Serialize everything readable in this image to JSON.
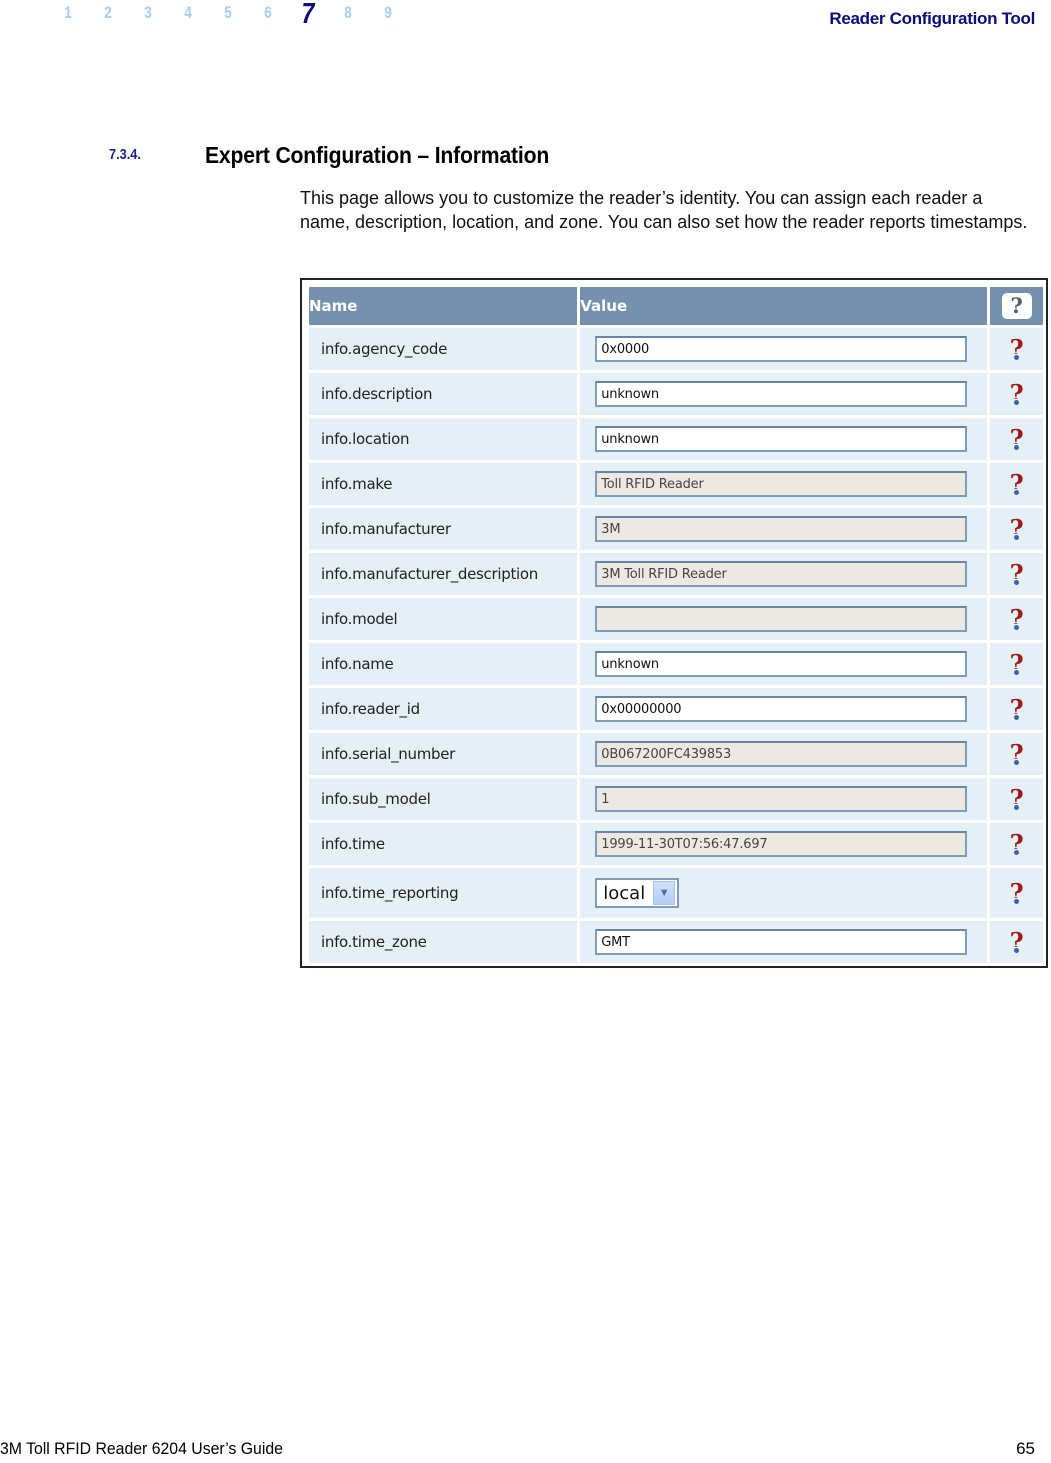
{
  "header": {
    "chapters": [
      "1",
      "2",
      "3",
      "4",
      "5",
      "6",
      "7",
      "8",
      "9"
    ],
    "active_chapter": "7",
    "doc_title": "Reader Configuration Tool"
  },
  "section": {
    "number": "7.3.4.",
    "title": "Expert Configuration – Information",
    "intro": "This page allows you to customize the reader’s identity. You can assign each reader a name, description, location, and zone. You can also set how the reader reports timestamps."
  },
  "table": {
    "columns": {
      "name": "Name",
      "value": "Value",
      "help": "?"
    },
    "rows": [
      {
        "name": "info.agency_code",
        "value": "0x0000",
        "readonly": false
      },
      {
        "name": "info.description",
        "value": "unknown",
        "readonly": false
      },
      {
        "name": "info.location",
        "value": "unknown",
        "readonly": false
      },
      {
        "name": "info.make",
        "value": "Toll RFID Reader",
        "readonly": true
      },
      {
        "name": "info.manufacturer",
        "value": "3M",
        "readonly": true
      },
      {
        "name": "info.manufacturer_description",
        "value": "3M Toll RFID Reader",
        "readonly": true
      },
      {
        "name": "info.model",
        "value": "",
        "readonly": true
      },
      {
        "name": "info.name",
        "value": "unknown",
        "readonly": false
      },
      {
        "name": "info.reader_id",
        "value": "0x00000000",
        "readonly": false
      },
      {
        "name": "info.serial_number",
        "value": "0B067200FC439853",
        "readonly": true
      },
      {
        "name": "info.sub_model",
        "value": "1",
        "readonly": true
      },
      {
        "name": "info.time",
        "value": "1999-11-30T07:56:47.697",
        "readonly": true
      },
      {
        "name": "info.time_reporting",
        "value": "local",
        "type": "select"
      },
      {
        "name": "info.time_zone",
        "value": "GMT",
        "readonly": false
      }
    ],
    "help_glyph": "?"
  },
  "footer": {
    "guide_title": "3M Toll RFID Reader 6204 User’s Guide",
    "page_number": "65"
  }
}
